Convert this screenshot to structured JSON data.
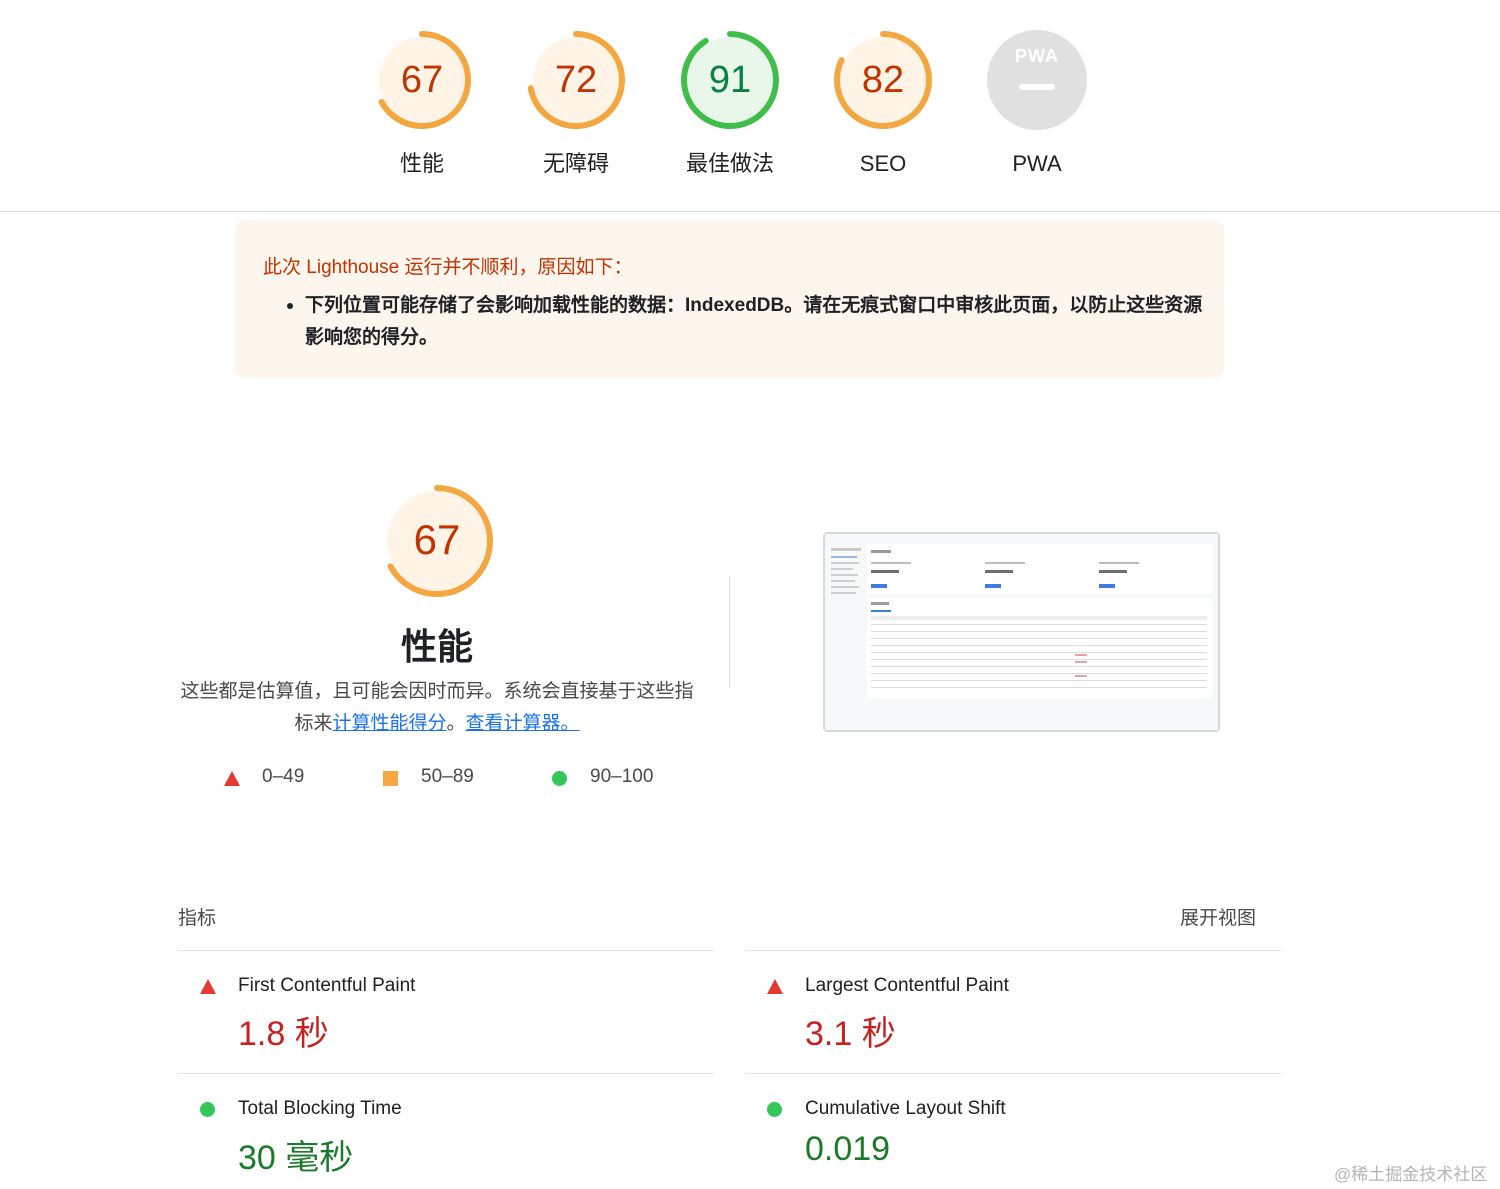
{
  "gauges": [
    {
      "score": "67",
      "label": "性能",
      "level": "average",
      "fraction": 0.67
    },
    {
      "score": "72",
      "label": "无障碍",
      "level": "average",
      "fraction": 0.72
    },
    {
      "score": "91",
      "label": "最佳做法",
      "level": "pass",
      "fraction": 0.91
    },
    {
      "score": "82",
      "label": "SEO",
      "level": "average",
      "fraction": 0.82
    },
    {
      "score": "",
      "label": "PWA",
      "level": "na",
      "badge": "PWA"
    }
  ],
  "warning": {
    "title": "此次 Lighthouse 运行并不顺利，原因如下：",
    "items": [
      "下列位置可能存储了会影响加载性能的数据：IndexedDB。请在无痕式窗口中审核此页面，以防止这些资源影响您的得分。"
    ]
  },
  "performance": {
    "score": "67",
    "fraction": 0.67,
    "title": "性能",
    "desc_prefix": "这些都是估算值，且可能会因时而异。系统会直接基于这些指标来",
    "link_calc": "计算性能得分",
    "desc_mid": "。",
    "link_view": "查看计算器。",
    "legend": [
      {
        "range": "0–49",
        "icon": "triangle-red"
      },
      {
        "range": "50–89",
        "icon": "square-orange"
      },
      {
        "range": "90–100",
        "icon": "circle-green"
      }
    ]
  },
  "metrics": {
    "title": "指标",
    "expand": "展开视图",
    "items": [
      {
        "name": "First Contentful Paint",
        "value": "1.8 秒",
        "status": "fail"
      },
      {
        "name": "Largest Contentful Paint",
        "value": "3.1 秒",
        "status": "fail"
      },
      {
        "name": "Total Blocking Time",
        "value": "30 毫秒",
        "status": "pass"
      },
      {
        "name": "Cumulative Layout Shift",
        "value": "0.019",
        "status": "pass"
      }
    ]
  },
  "colors": {
    "average": "#f4a640",
    "average_bg": "#fff4e6",
    "pass": "#3fbf4a",
    "pass_bg": "#e9f7eb",
    "fail": "#c5221f",
    "na": "#e0e0e0"
  },
  "watermark": "@稀土掘金技术社区"
}
